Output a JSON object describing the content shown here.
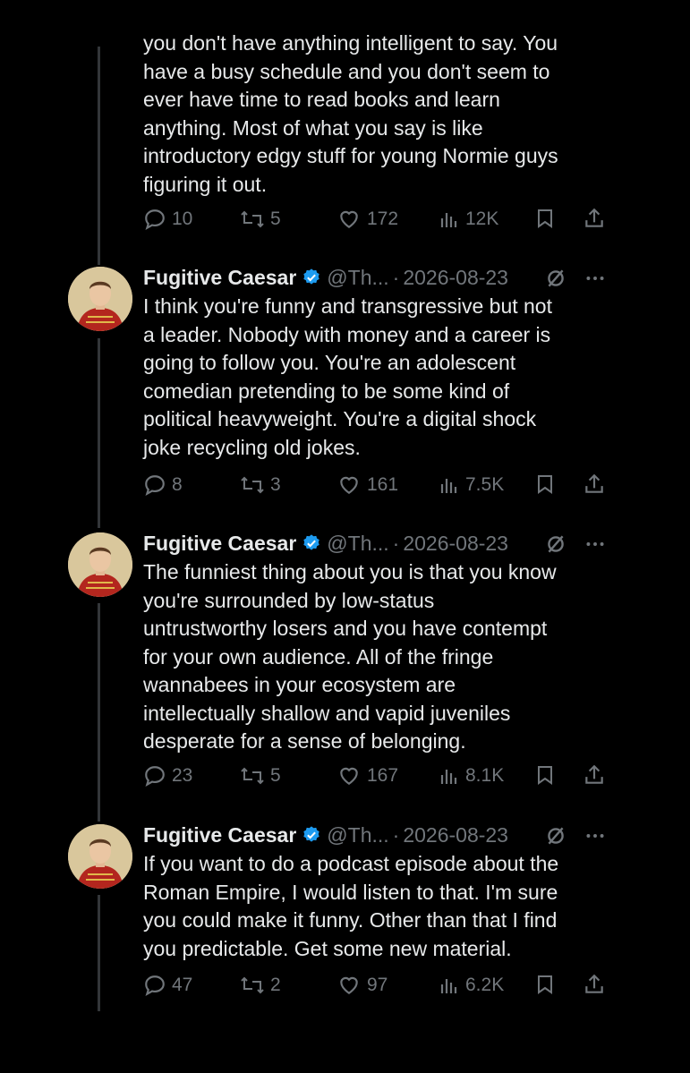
{
  "colors": {
    "background": "#000000",
    "text": "#e7e9ea",
    "muted": "#71767b",
    "verified": "#1d9bf0",
    "thread_line": "#333639"
  },
  "partial_tweet": {
    "text": "you don't have anything intelligent to say. You\nhave a busy schedule and you don't seem to\never have time to read books and learn\nanything. Most of what you say is like\nintroductory edgy stuff for young Normie guys\nfiguring it out.",
    "replies": "10",
    "retweets": "5",
    "likes": "172",
    "views": "12K"
  },
  "tweets": [
    {
      "name": "Fugitive Caesar",
      "handle": "@Th...",
      "dot": "·",
      "date": "2026-08-23",
      "text": "I think you're funny and transgressive but not\na leader. Nobody with money and a career is\ngoing to follow you. You're an adolescent\ncomedian pretending to be some kind of\npolitical heavyweight. You're a digital shock\njoke recycling old jokes.",
      "replies": "8",
      "retweets": "3",
      "likes": "161",
      "views": "7.5K"
    },
    {
      "name": "Fugitive Caesar",
      "handle": "@Th...",
      "dot": "·",
      "date": "2026-08-23",
      "text": "The funniest thing about you is that you know\nyou're surrounded by low-status\nuntrustworthy losers and you have contempt\nfor your own audience. All of the fringe\nwannabees in your ecosystem are\nintellectually shallow and vapid juveniles\ndesperate for a sense of belonging.",
      "replies": "23",
      "retweets": "5",
      "likes": "167",
      "views": "8.1K"
    },
    {
      "name": "Fugitive Caesar",
      "handle": "@Th...",
      "dot": "·",
      "date": "2026-08-23",
      "text": "If you want to do a podcast episode about the\nRoman Empire, I would listen to that. I'm sure\nyou could make it funny. Other than that I find\nyou predictable. Get some new material.",
      "replies": "47",
      "retweets": "2",
      "likes": "97",
      "views": "6.2K"
    }
  ]
}
